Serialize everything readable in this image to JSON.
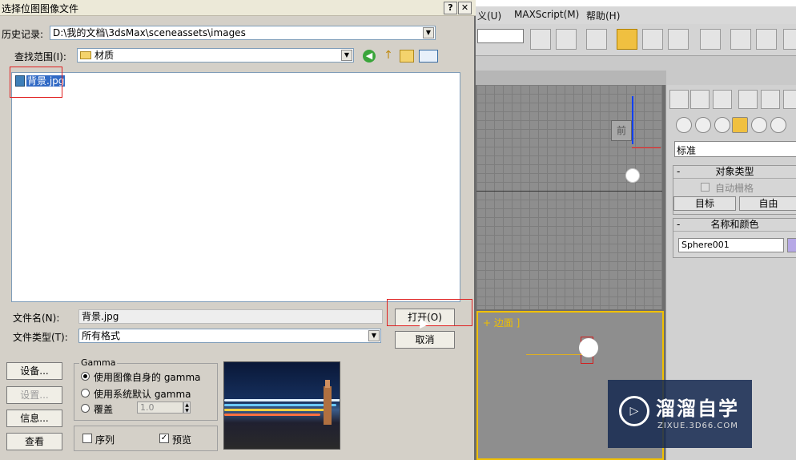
{
  "max": {
    "menu": [
      "义(U)",
      "MAXScript(M)",
      "帮助(H)"
    ],
    "cmd_panel": {
      "dropdown_value": "标准",
      "rollout_object_type": {
        "title": "对象类型",
        "autogrid_label": "自动栅格",
        "btn_target": "目标",
        "btn_free": "自由"
      },
      "rollout_name_color": {
        "title": "名称和颜色",
        "name_value": "Sphere001"
      },
      "minus": "-"
    },
    "viewport_label": "+ 边面 ]",
    "viewcube_label": "前",
    "watermark": {
      "title": "溜溜自学",
      "url": "ZIXUE.3D66.COM"
    },
    "colors": {
      "accent": "#f0c000",
      "swatch": "#b6a8e6"
    }
  },
  "dialog": {
    "title": "选择位图图像文件",
    "help_btn": "?",
    "close_btn": "✕",
    "history_label": "历史记录:",
    "history_value": "D:\\我的文档\\3dsMax\\sceneassets\\images",
    "lookin_label": "查找范围(I):",
    "lookin_value": "材质",
    "files": [
      {
        "name": "背景.jpg"
      }
    ],
    "filename_label": "文件名(N):",
    "filename_value": "背景.jpg",
    "filetype_label": "文件类型(T):",
    "filetype_value": "所有格式",
    "open_btn": "打开(O)",
    "cancel_btn": "取消",
    "setup_btn": "设备...",
    "settings_btn": "设置...",
    "info_btn": "信息...",
    "view_btn": "查看",
    "gamma": {
      "title": "Gamma",
      "opt_image": "使用图像自身的 gamma",
      "opt_system": "使用系统默认 gamma",
      "opt_override": "覆盖",
      "override_value": "1.0"
    },
    "sequence_label": "序列",
    "preview_label": "预览",
    "icons": [
      "back-icon",
      "up-folder-icon",
      "new-folder-icon",
      "view-menu-icon"
    ]
  }
}
